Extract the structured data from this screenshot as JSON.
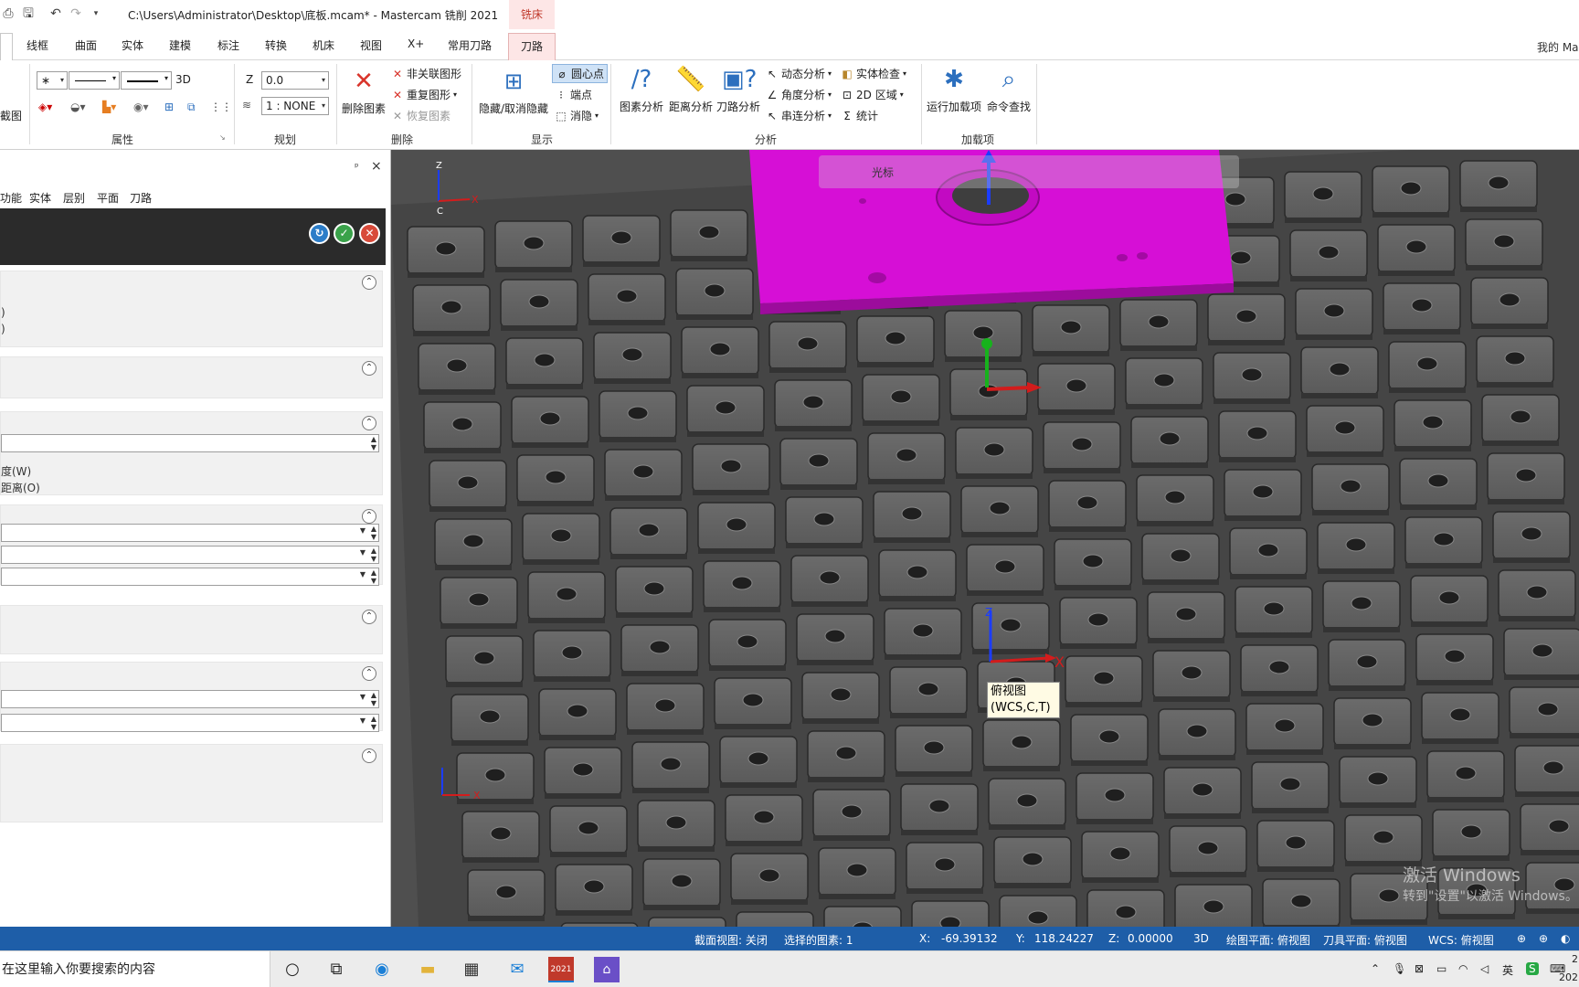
{
  "title_bar": {
    "path": "C:\\Users\\Administrator\\Desktop\\底板.mcam* - Mastercam 铣削 2021",
    "context_tab": "铣床"
  },
  "menu": {
    "tabs": [
      "线框",
      "曲面",
      "实体",
      "建模",
      "标注",
      "转换",
      "机床",
      "视图",
      "X+",
      "常用刀路"
    ],
    "active_context_tab": "刀路",
    "user": "我的 Ma"
  },
  "ribbon": {
    "clipped_left_label": "截图",
    "attributes": {
      "label": "属性",
      "mode_3d": "3D"
    },
    "planning": {
      "label": "规划",
      "z_label": "Z",
      "z_value": "0.0",
      "level_value": "1 : NONE"
    },
    "delete": {
      "label": "删除",
      "delete_entities": "删除图素",
      "non_associated": "非关联图形",
      "duplicate": "重复图形",
      "restore": "恢复图素"
    },
    "display": {
      "label": "显示",
      "hide_unhide": "隐藏/取消隐藏",
      "center_point": "圆心点",
      "endpoint": "端点",
      "blank": "消隐"
    },
    "analyze": {
      "label": "分析",
      "entity_analysis": "图素分析",
      "distance_analysis": "距离分析",
      "toolpath_analysis": "刀路分析",
      "dynamic_analysis": "动态分析",
      "angle_analysis": "角度分析",
      "chain_analysis": "串连分析",
      "solid_check": "实体检查",
      "area_2d": "2D 区域",
      "statistics": "统计"
    },
    "addins": {
      "label": "加载项",
      "run_addin": "运行加载项",
      "command_finder": "命令查找"
    }
  },
  "left_panel": {
    "pin": "ᵖ",
    "close": "×",
    "tabs": [
      "功能",
      "实体",
      "层别",
      "平面",
      "刀路"
    ],
    "section1_lines": [
      ")",
      ")"
    ],
    "section3_options": [
      "度(W)",
      "距离(O)"
    ]
  },
  "viewport": {
    "hud_label": "光标",
    "wcs_tooltip_line1": "俯视图",
    "wcs_tooltip_line2": "(WCS,C,T)",
    "axis_x": "X",
    "axis_z": "Z",
    "axis_c": "C",
    "activate_line1": "激活 Windows",
    "activate_line2": "转到\"设置\"以激活 Windows。"
  },
  "status_bar": {
    "section_view": "截面视图: 关闭",
    "selected": "选择的图素: 1",
    "x_label": "X:",
    "x_value": "-69.39132",
    "y_label": "Y:",
    "y_value": "118.24227",
    "z_label": "Z:",
    "z_value": "0.00000",
    "mode": "3D",
    "draw_plane": "绘图平面: 俯视图",
    "tool_plane": "刀具平面: 俯视图",
    "wcs": "WCS: 俯视图"
  },
  "taskbar": {
    "search_text": "在这里输入你要搜索的内容",
    "app_badge": "2021",
    "ime": "英",
    "clock_top": "2",
    "clock_bottom": "202"
  },
  "colors": {
    "part_magenta": "#d60fd6",
    "status_blue": "#1e5ea8",
    "fixture_plate": "#4f4f4f"
  }
}
